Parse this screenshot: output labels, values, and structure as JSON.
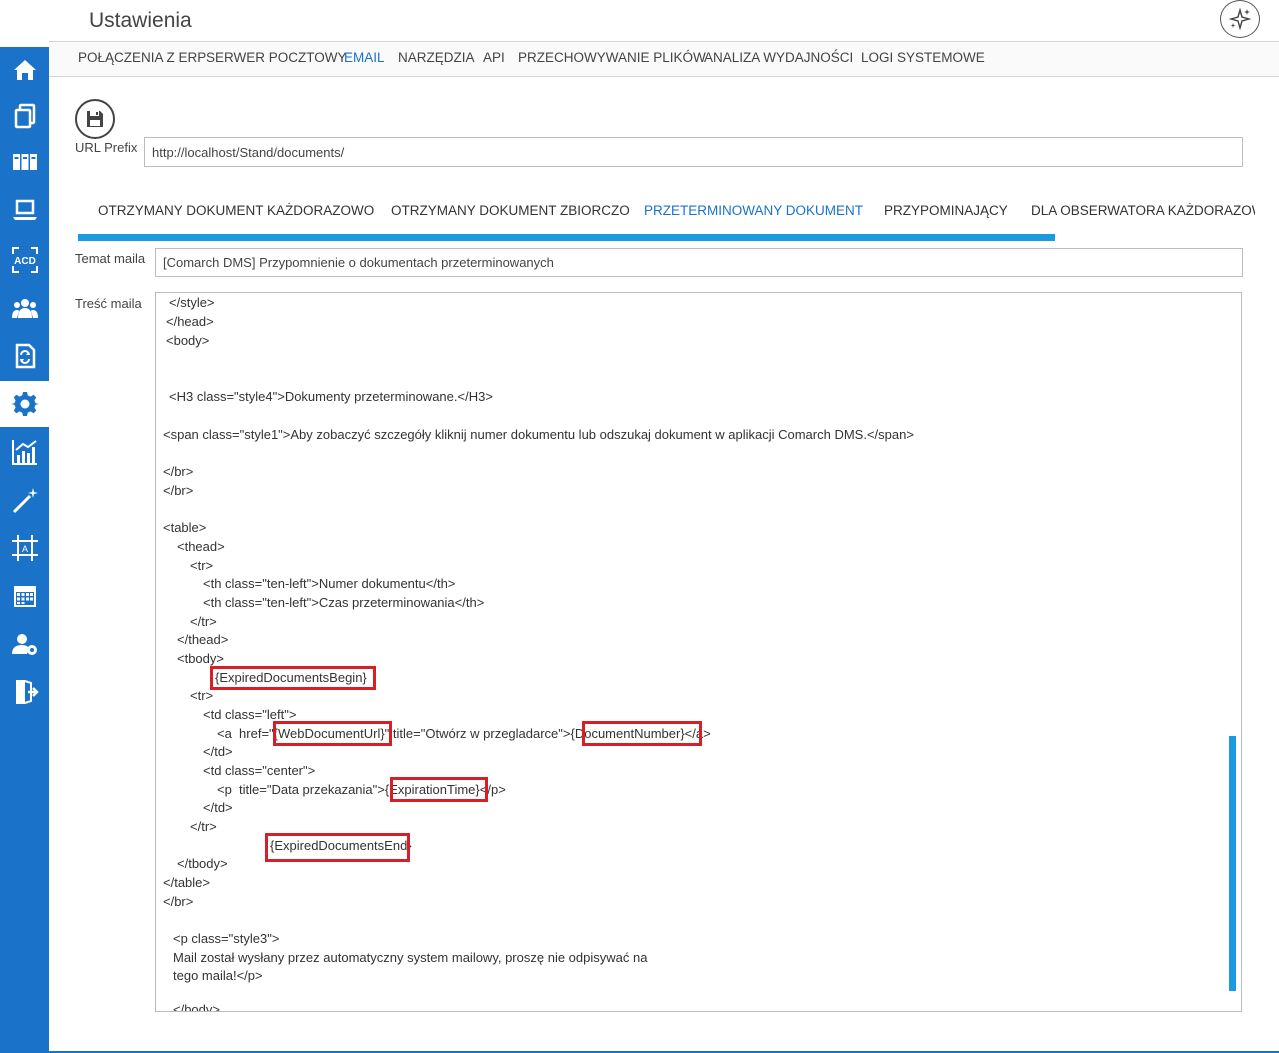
{
  "window": {
    "title": "Ustawienia"
  },
  "sidebar": {
    "items": [
      {
        "icon": "home-icon"
      },
      {
        "icon": "documents-icon"
      },
      {
        "icon": "binders-icon"
      },
      {
        "icon": "laptop-icon"
      },
      {
        "icon": "acd-icon",
        "label": "ACD"
      },
      {
        "icon": "users-icon"
      },
      {
        "icon": "document-sync-icon"
      },
      {
        "icon": "gear-icon",
        "active": true
      },
      {
        "icon": "chart-icon"
      },
      {
        "icon": "magic-wand-icon"
      },
      {
        "icon": "frame-icon",
        "label": "A"
      },
      {
        "icon": "calendar-icon"
      },
      {
        "icon": "user-settings-icon"
      },
      {
        "icon": "logout-icon"
      }
    ],
    "colors": {
      "background": "#1a73c9",
      "active": "#ffffff"
    }
  },
  "topnav": {
    "tabs": [
      {
        "label": "POŁĄCZENIA Z ERP"
      },
      {
        "label": "SERWER POCZTOWY"
      },
      {
        "label": "EMAIL",
        "active": true
      },
      {
        "label": "NARZĘDZIA"
      },
      {
        "label": "API"
      },
      {
        "label": "PRZECHOWYWANIE PLIKÓW"
      },
      {
        "label": "ANALIZA WYDAJNOŚCI"
      },
      {
        "label": "LOGI SYSTEMOWE"
      }
    ]
  },
  "form": {
    "url_prefix_label": "URL Prefix",
    "url_prefix_value": "http://localhost/Stand/documents/",
    "subject_label": "Temat maila",
    "subject_value": "[Comarch DMS] Przypomnienie o dokumentach przeterminowanych",
    "body_label": "Treść maila"
  },
  "subtabs": [
    {
      "label": "OTRZYMANY DOKUMENT KAŻDORAZOWO"
    },
    {
      "label": "OTRZYMANY DOKUMENT ZBIORCZO"
    },
    {
      "label": "PRZETERMINOWANY DOKUMENT",
      "active": true
    },
    {
      "label": "PRZYPOMINAJĄCY"
    },
    {
      "label": "DLA OBSERWATORA KAŻDORAZOWC"
    }
  ],
  "editor": {
    "lines": [
      "</style>",
      "</head>",
      "<body>",
      "<H3 class=\"style4\">Dokumenty przeterminowane.</H3>",
      "<span class=\"style1\">Aby zobaczyć szczegóły kliknij numer dokumentu lub odszukaj dokument w aplikacji Comarch DMS.</span>",
      "</br>",
      "</br>",
      "<table>",
      "<thead>",
      "<tr>",
      "<th class=\"ten-left\">Numer dokumentu</th>",
      "<th class=\"ten-left\">Czas przeterminowania</th>",
      "</tr>",
      "</thead>",
      "<tbody>",
      "{ExpiredDocumentsBegin}",
      "<tr>",
      "<td class=\"left\">",
      "<a  href=\"{WebDocumentUrl}\" title=\"Otwórz w przegladarce\">{DocumentNumber}</a>",
      "</td>",
      "<td class=\"center\">",
      "<p  title=\"Data przekazania\">{ExpirationTime}</p>",
      "</td>",
      "</tr>",
      "{ExpiredDocumentsEnd}",
      "</tbody>",
      "</table>",
      "</br>",
      "<p class=\"style3\">",
      "Mail został wysłany przez automatyczny system mailowy, proszę nie odpisywać na",
      "tego maila!</p>",
      "</body>"
    ],
    "highlight_color": "#d91f26"
  },
  "accent_color": "#1a9be0"
}
